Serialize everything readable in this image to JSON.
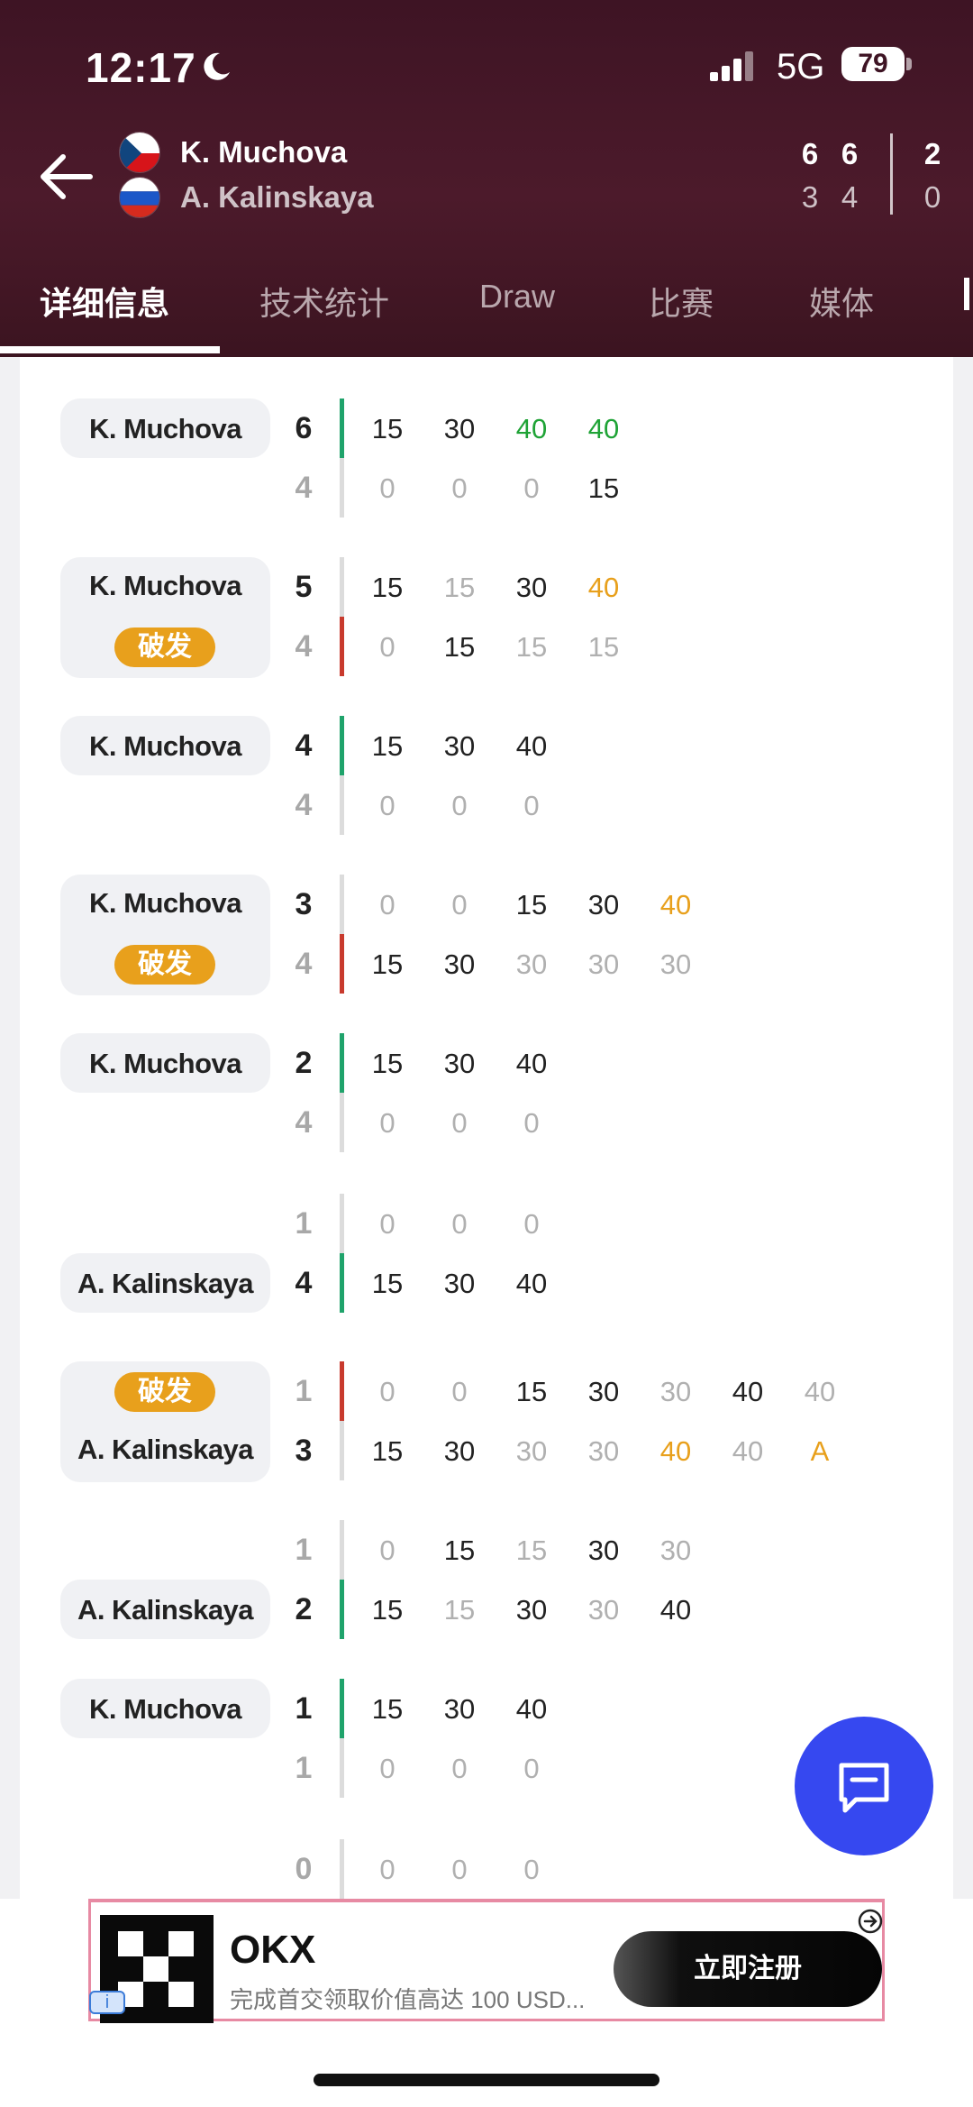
{
  "status_bar": {
    "time": "12:17",
    "network": "5G",
    "battery": "79"
  },
  "header": {
    "player1": {
      "name": "K. Muchova",
      "flag": "czech-flag",
      "scores": [
        "6",
        "6",
        "2"
      ]
    },
    "player2": {
      "name": "A. Kalinskaya",
      "flag": "russia-flag",
      "scores": [
        "3",
        "4",
        "0"
      ]
    }
  },
  "tabs": [
    "详细信息",
    "技术统计",
    "Draw",
    "比赛",
    "媒体"
  ],
  "active_tab": "详细信息",
  "break_label": "破发",
  "games": [
    {
      "server": "K. Muchova",
      "break": false,
      "top": {
        "score": "6",
        "points": [
          "15",
          "30",
          "40",
          "40"
        ]
      },
      "bottom": {
        "score": "4",
        "points": [
          "0",
          "0",
          "0",
          "15"
        ]
      }
    },
    {
      "server": "K. Muchova",
      "break": true,
      "top": {
        "score": "5",
        "points": [
          "15",
          "15",
          "30",
          "40"
        ]
      },
      "bottom": {
        "score": "4",
        "points": [
          "0",
          "15",
          "15",
          "15"
        ]
      }
    },
    {
      "server": "K. Muchova",
      "break": false,
      "top": {
        "score": "4",
        "points": [
          "15",
          "30",
          "40"
        ]
      },
      "bottom": {
        "score": "4",
        "points": [
          "0",
          "0",
          "0"
        ]
      }
    },
    {
      "server": "K. Muchova",
      "break": true,
      "top": {
        "score": "3",
        "points": [
          "0",
          "0",
          "15",
          "30",
          "40"
        ]
      },
      "bottom": {
        "score": "4",
        "points": [
          "15",
          "30",
          "30",
          "30",
          "30"
        ]
      }
    },
    {
      "server": "K. Muchova",
      "break": false,
      "top": {
        "score": "2",
        "points": [
          "15",
          "30",
          "40"
        ]
      },
      "bottom": {
        "score": "4",
        "points": [
          "0",
          "0",
          "0"
        ]
      }
    },
    {
      "server": "A. Kalinskaya",
      "break": false,
      "top": {
        "score": "1",
        "points": [
          "0",
          "0",
          "0"
        ]
      },
      "bottom": {
        "score": "4",
        "points": [
          "15",
          "30",
          "40"
        ]
      }
    },
    {
      "server": "A. Kalinskaya",
      "break": true,
      "top": {
        "score": "1",
        "points": [
          "0",
          "0",
          "15",
          "30",
          "30",
          "40",
          "40"
        ]
      },
      "bottom": {
        "score": "3",
        "points": [
          "15",
          "30",
          "30",
          "30",
          "40",
          "40",
          "A"
        ]
      }
    },
    {
      "server": "A. Kalinskaya",
      "break": false,
      "top": {
        "score": "1",
        "points": [
          "0",
          "15",
          "15",
          "30",
          "30"
        ]
      },
      "bottom": {
        "score": "2",
        "points": [
          "15",
          "15",
          "30",
          "30",
          "40"
        ]
      }
    },
    {
      "server": "K. Muchova",
      "break": false,
      "top": {
        "score": "1",
        "points": [
          "15",
          "30",
          "40"
        ]
      },
      "bottom": {
        "score": "1",
        "points": [
          "0",
          "0",
          "0"
        ]
      }
    },
    {
      "server": "",
      "break": false,
      "top": {
        "score": "0",
        "points": [
          "0",
          "0",
          "0"
        ]
      }
    }
  ],
  "fab": {
    "icon": "chat-icon"
  },
  "ad": {
    "brand": "OKX",
    "subtitle": "完成首交领取价值高达 100 USD...",
    "cta": "立即注册",
    "info_icon": "info-icon",
    "close_icon": "arrow-right-circle-icon"
  },
  "colors": {
    "header_bg": "#3e1424",
    "green": "#1fa336",
    "orange": "#e8a01c",
    "red": "#c83a2d",
    "fab": "#3648f0",
    "ad_border": "#e78aa3"
  }
}
